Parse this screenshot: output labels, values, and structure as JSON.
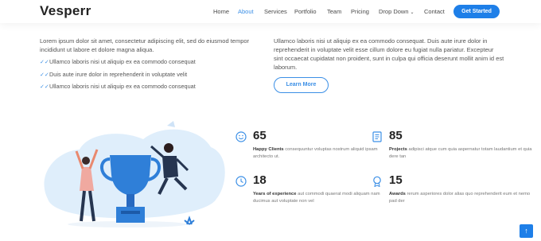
{
  "header": {
    "logo": "Vesperr",
    "nav": [
      "Home",
      "About",
      "Services",
      "Portfolio",
      "Team",
      "Pricing",
      "Drop Down",
      "Contact"
    ],
    "active": "About",
    "cta": "Get Started"
  },
  "about": {
    "lead": "Lorem ipsum dolor sit amet, consectetur adipiscing elit, sed do eiusmod tempor incididunt ut labore et dolore magna aliqua.",
    "checks": [
      "Ullamco laboris nisi ut aliquip ex ea commodo consequat",
      "Duis aute irure dolor in reprehenderit in voluptate velit",
      "Ullamco laboris nisi ut aliquip ex ea commodo consequat"
    ],
    "para2": "Ullamco laboris nisi ut aliquip ex ea commodo consequat. Duis aute irure dolor in reprehenderit in voluptate velit esse cillum dolore eu fugiat nulla pariatur. Excepteur sint occaecat cupidatat non proident, sunt in culpa qui officia deserunt mollit anim id est laborum.",
    "learn_more": "Learn More"
  },
  "stats": [
    {
      "number": "65",
      "label": "Happy Clients",
      "text": "consequuntur voluptas nostrum aliquid ipsam architecto ut.",
      "icon": "smiley-icon"
    },
    {
      "number": "85",
      "label": "Projects",
      "text": "adipisci atque cum quia aspernatur totam laudantium et quia dere tan",
      "icon": "document-list-icon"
    },
    {
      "number": "18",
      "label": "Years of experience",
      "text": "aut commodi quaerat modi aliquam nam ducimus aut voluptate non vel",
      "icon": "clock-icon"
    },
    {
      "number": "15",
      "label": "Awards",
      "text": "rerum asperiores dolor alias quo reprehenderit eum et nemo pad der",
      "icon": "award-icon"
    }
  ],
  "colors": {
    "accent": "#1e7fe8",
    "link": "#3b8fe6"
  },
  "back_to_top_icon": "arrow-up-icon"
}
